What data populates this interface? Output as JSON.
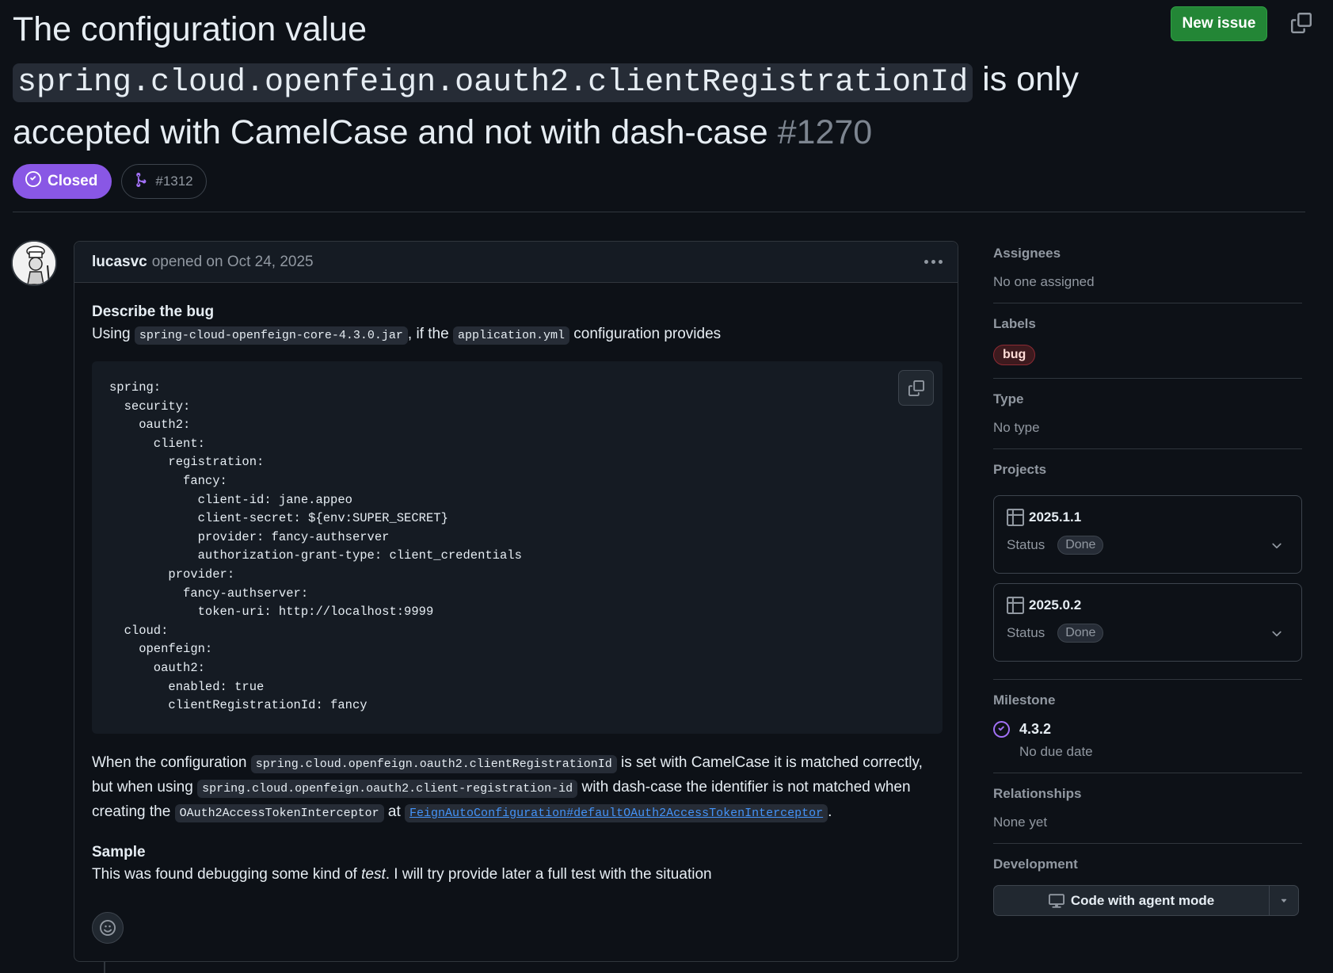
{
  "issue": {
    "title_before": "The configuration value",
    "title_code": "spring.cloud.openfeign.oauth2.clientRegistrationId",
    "title_after": "is only accepted with CamelCase and not with dash-case",
    "number": "#1270",
    "state": "Closed",
    "linked_pr": "#1312"
  },
  "header": {
    "new_issue_label": "New issue"
  },
  "comment": {
    "author": "lucasvc",
    "meta": "opened on Oct 24, 2025",
    "heading_bug": "Describe the bug",
    "p1_a": "Using",
    "p1_code1": "spring-cloud-openfeign-core-4.3.0.jar",
    "p1_b": ", if the",
    "p1_code2": "application.yml",
    "p1_c": "configuration provides",
    "code": "spring:\n  security:\n    oauth2:\n      client:\n        registration:\n          fancy:\n            client-id: jane.appeo\n            client-secret: ${env:SUPER_SECRET}\n            provider: fancy-authserver\n            authorization-grant-type: client_credentials\n        provider:\n          fancy-authserver:\n            token-uri: http://localhost:9999\n  cloud:\n    openfeign:\n      oauth2:\n        enabled: true\n        clientRegistrationId: fancy",
    "p2_a": "When the configuration",
    "p2_code1": "spring.cloud.openfeign.oauth2.clientRegistrationId",
    "p2_b": "is set with CamelCase it is matched correctly, but when using",
    "p2_code2": "spring.cloud.openfeign.oauth2.client-registration-id",
    "p2_c": "with dash-case the identifier is not matched when creating the",
    "p2_code3": "OAuth2AccessTokenInterceptor",
    "p2_d": "at",
    "p2_link": "FeignAutoConfiguration#defaultOAuth2AccessTokenInterceptor",
    "p2_e": ".",
    "heading_sample": "Sample",
    "p3_a": "This was found debugging some kind of",
    "p3_em": "test",
    "p3_b": ". I will try provide later a full test with the situation"
  },
  "sidebar": {
    "assignees_title": "Assignees",
    "assignees_value": "No one assigned",
    "labels_title": "Labels",
    "label_bug": "bug",
    "type_title": "Type",
    "type_value": "No type",
    "projects_title": "Projects",
    "projects": [
      {
        "name": "2025.1.1",
        "status_label": "Status",
        "status": "Done"
      },
      {
        "name": "2025.0.2",
        "status_label": "Status",
        "status": "Done"
      }
    ],
    "milestone_title": "Milestone",
    "milestone_name": "4.3.2",
    "milestone_due": "No due date",
    "relationships_title": "Relationships",
    "relationships_value": "None yet",
    "development_title": "Development",
    "agent_button": "Code with agent mode"
  },
  "colors": {
    "closed_badge": "#8957e5",
    "new_issue_button": "#238636",
    "link": "#4493f8",
    "background": "#0d1117"
  },
  "icons": [
    "copy-icon",
    "closed-check-icon",
    "pull-request-icon",
    "kebab-icon",
    "smiley-icon",
    "table-icon",
    "chevron-down-icon",
    "milestone-icon",
    "agent-icon",
    "triangle-down-icon"
  ]
}
